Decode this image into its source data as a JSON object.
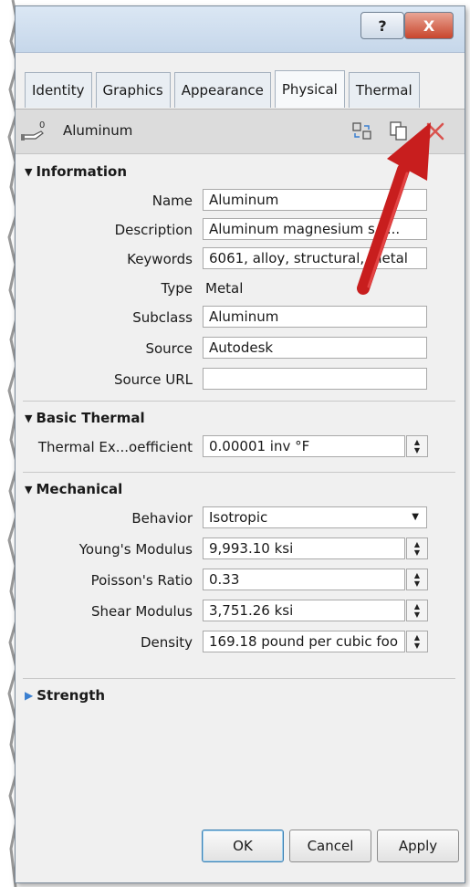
{
  "titlebar": {
    "help_label": "?",
    "close_label": "X"
  },
  "tabs": [
    {
      "label": "Identity"
    },
    {
      "label": "Graphics"
    },
    {
      "label": "Appearance"
    },
    {
      "label": "Physical"
    },
    {
      "label": "Thermal"
    }
  ],
  "material": {
    "name": "Aluminum"
  },
  "sections": {
    "information": "Information",
    "basic_thermal": "Basic Thermal",
    "mechanical": "Mechanical",
    "strength": "Strength"
  },
  "information": {
    "name": {
      "label": "Name",
      "value": "Aluminum"
    },
    "description": {
      "label": "Description",
      "value": "Aluminum magnesium s c..."
    },
    "keywords": {
      "label": "Keywords",
      "value": "6061, alloy, structural, metal"
    },
    "type": {
      "label": "Type",
      "value": "Metal"
    },
    "subclass": {
      "label": "Subclass",
      "value": "Aluminum"
    },
    "source": {
      "label": "Source",
      "value": "Autodesk"
    },
    "source_url": {
      "label": "Source URL",
      "value": ""
    }
  },
  "basic_thermal": {
    "expansion": {
      "label": "Thermal Ex...oefficient",
      "value": "0.00001 inv °F"
    }
  },
  "mechanical": {
    "behavior": {
      "label": "Behavior",
      "value": "Isotropic"
    },
    "youngs": {
      "label": "Young's Modulus",
      "value": "9,993.10 ksi"
    },
    "poisson": {
      "label": "Poisson's Ratio",
      "value": "0.33"
    },
    "shear": {
      "label": "Shear Modulus",
      "value": "3,751.26 ksi"
    },
    "density": {
      "label": "Density",
      "value": "169.18 pound per cubic foo"
    }
  },
  "buttons": {
    "ok": "OK",
    "cancel": "Cancel",
    "apply": "Apply"
  },
  "colors": {
    "accent_arrow": "#d01f1f",
    "delete_icon": "#d9534f"
  }
}
